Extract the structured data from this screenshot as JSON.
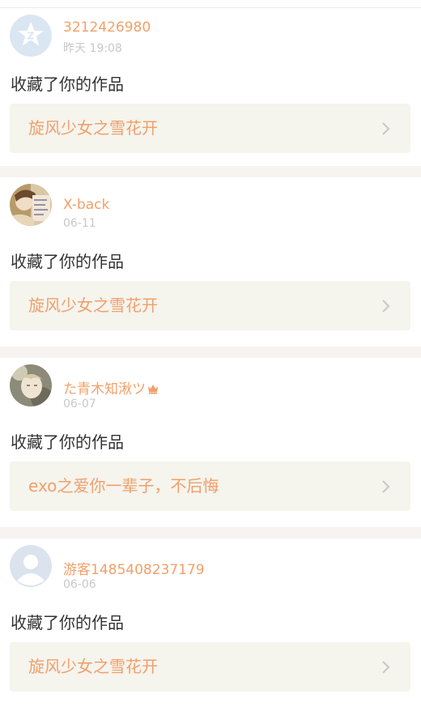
{
  "feed": {
    "items": [
      {
        "username": "3212426980",
        "time": "昨天 19:08",
        "action": "收藏了你的作品",
        "work_title": "旋风少女之雪花开",
        "avatar_icon": "qzone-star-avatar-icon",
        "has_crown": false
      },
      {
        "username": "X-back",
        "time": "06-11",
        "action": "收藏了你的作品",
        "work_title": "旋风少女之雪花开",
        "avatar_icon": "photo-avatar",
        "has_crown": false
      },
      {
        "username": "た青木知湫ツ",
        "time": "06-07",
        "action": "收藏了你的作品",
        "work_title": "exo之爱你一辈子，不后悔",
        "avatar_icon": "photo-avatar",
        "has_crown": true
      },
      {
        "username": "游客1485408237179",
        "time": "06-06",
        "action": "收藏了你的作品",
        "work_title": "旋风少女之雪花开",
        "avatar_icon": "default-user-avatar-icon",
        "has_crown": false
      }
    ]
  },
  "colors": {
    "username": "#f2a06a",
    "time": "#c8c8c8",
    "action_text": "#333333",
    "work_card_bg": "#f5f4ed",
    "work_title": "#f0a06c",
    "separator": "#f6f3f0"
  }
}
